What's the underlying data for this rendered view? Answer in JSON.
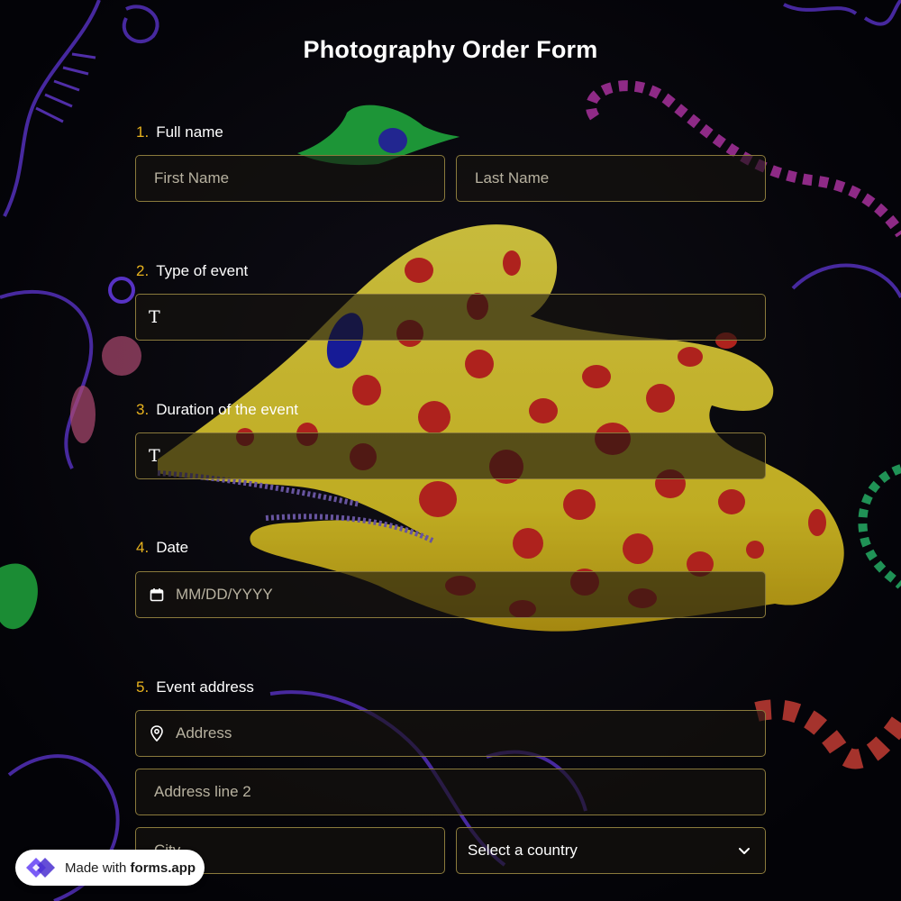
{
  "form": {
    "title": "Photography Order Form"
  },
  "questions": [
    {
      "number": "1.",
      "label": "Full name",
      "fields": [
        {
          "placeholder": "First Name"
        },
        {
          "placeholder": "Last Name"
        }
      ]
    },
    {
      "number": "2.",
      "label": "Type of event",
      "fields": [
        {
          "icon": "text-type-icon",
          "placeholder": ""
        }
      ]
    },
    {
      "number": "3.",
      "label": "Duration of the event",
      "fields": [
        {
          "icon": "text-type-icon",
          "placeholder": ""
        }
      ]
    },
    {
      "number": "4.",
      "label": "Date",
      "fields": [
        {
          "icon": "calendar-icon",
          "placeholder": "MM/DD/YYYY"
        }
      ]
    },
    {
      "number": "5.",
      "label": "Event address",
      "fields": [
        {
          "icon": "location-pin-icon",
          "placeholder": "Address"
        },
        {
          "placeholder": "Address line 2"
        },
        {
          "placeholder": "City"
        },
        {
          "type": "select",
          "value": "Select a country",
          "icon": "chevron-down-icon"
        }
      ]
    }
  ],
  "badge": {
    "made_with": "Made with",
    "brand": "forms.app",
    "icon": "forms-app-logo-icon"
  },
  "colors": {
    "accent": "#e7b21e",
    "field_border": "#8a7a3c",
    "title": "#ffffff"
  }
}
